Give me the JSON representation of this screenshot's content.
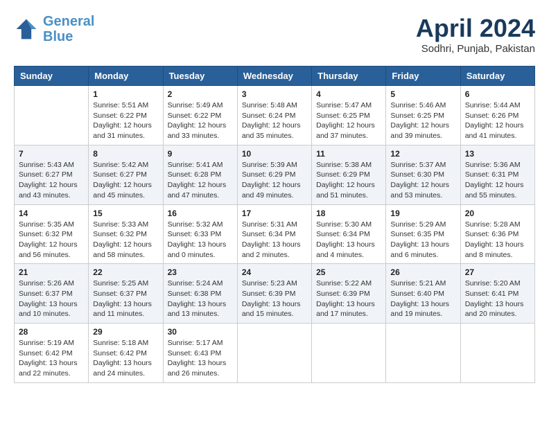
{
  "header": {
    "logo_line1": "General",
    "logo_line2": "Blue",
    "month": "April 2024",
    "location": "Sodhri, Punjab, Pakistan"
  },
  "days_of_week": [
    "Sunday",
    "Monday",
    "Tuesday",
    "Wednesday",
    "Thursday",
    "Friday",
    "Saturday"
  ],
  "weeks": [
    [
      {
        "day": "",
        "info": ""
      },
      {
        "day": "1",
        "info": "Sunrise: 5:51 AM\nSunset: 6:22 PM\nDaylight: 12 hours\nand 31 minutes."
      },
      {
        "day": "2",
        "info": "Sunrise: 5:49 AM\nSunset: 6:22 PM\nDaylight: 12 hours\nand 33 minutes."
      },
      {
        "day": "3",
        "info": "Sunrise: 5:48 AM\nSunset: 6:24 PM\nDaylight: 12 hours\nand 35 minutes."
      },
      {
        "day": "4",
        "info": "Sunrise: 5:47 AM\nSunset: 6:25 PM\nDaylight: 12 hours\nand 37 minutes."
      },
      {
        "day": "5",
        "info": "Sunrise: 5:46 AM\nSunset: 6:25 PM\nDaylight: 12 hours\nand 39 minutes."
      },
      {
        "day": "6",
        "info": "Sunrise: 5:44 AM\nSunset: 6:26 PM\nDaylight: 12 hours\nand 41 minutes."
      }
    ],
    [
      {
        "day": "7",
        "info": "Sunrise: 5:43 AM\nSunset: 6:27 PM\nDaylight: 12 hours\nand 43 minutes."
      },
      {
        "day": "8",
        "info": "Sunrise: 5:42 AM\nSunset: 6:27 PM\nDaylight: 12 hours\nand 45 minutes."
      },
      {
        "day": "9",
        "info": "Sunrise: 5:41 AM\nSunset: 6:28 PM\nDaylight: 12 hours\nand 47 minutes."
      },
      {
        "day": "10",
        "info": "Sunrise: 5:39 AM\nSunset: 6:29 PM\nDaylight: 12 hours\nand 49 minutes."
      },
      {
        "day": "11",
        "info": "Sunrise: 5:38 AM\nSunset: 6:29 PM\nDaylight: 12 hours\nand 51 minutes."
      },
      {
        "day": "12",
        "info": "Sunrise: 5:37 AM\nSunset: 6:30 PM\nDaylight: 12 hours\nand 53 minutes."
      },
      {
        "day": "13",
        "info": "Sunrise: 5:36 AM\nSunset: 6:31 PM\nDaylight: 12 hours\nand 55 minutes."
      }
    ],
    [
      {
        "day": "14",
        "info": "Sunrise: 5:35 AM\nSunset: 6:32 PM\nDaylight: 12 hours\nand 56 minutes."
      },
      {
        "day": "15",
        "info": "Sunrise: 5:33 AM\nSunset: 6:32 PM\nDaylight: 12 hours\nand 58 minutes."
      },
      {
        "day": "16",
        "info": "Sunrise: 5:32 AM\nSunset: 6:33 PM\nDaylight: 13 hours\nand 0 minutes."
      },
      {
        "day": "17",
        "info": "Sunrise: 5:31 AM\nSunset: 6:34 PM\nDaylight: 13 hours\nand 2 minutes."
      },
      {
        "day": "18",
        "info": "Sunrise: 5:30 AM\nSunset: 6:34 PM\nDaylight: 13 hours\nand 4 minutes."
      },
      {
        "day": "19",
        "info": "Sunrise: 5:29 AM\nSunset: 6:35 PM\nDaylight: 13 hours\nand 6 minutes."
      },
      {
        "day": "20",
        "info": "Sunrise: 5:28 AM\nSunset: 6:36 PM\nDaylight: 13 hours\nand 8 minutes."
      }
    ],
    [
      {
        "day": "21",
        "info": "Sunrise: 5:26 AM\nSunset: 6:37 PM\nDaylight: 13 hours\nand 10 minutes."
      },
      {
        "day": "22",
        "info": "Sunrise: 5:25 AM\nSunset: 6:37 PM\nDaylight: 13 hours\nand 11 minutes."
      },
      {
        "day": "23",
        "info": "Sunrise: 5:24 AM\nSunset: 6:38 PM\nDaylight: 13 hours\nand 13 minutes."
      },
      {
        "day": "24",
        "info": "Sunrise: 5:23 AM\nSunset: 6:39 PM\nDaylight: 13 hours\nand 15 minutes."
      },
      {
        "day": "25",
        "info": "Sunrise: 5:22 AM\nSunset: 6:39 PM\nDaylight: 13 hours\nand 17 minutes."
      },
      {
        "day": "26",
        "info": "Sunrise: 5:21 AM\nSunset: 6:40 PM\nDaylight: 13 hours\nand 19 minutes."
      },
      {
        "day": "27",
        "info": "Sunrise: 5:20 AM\nSunset: 6:41 PM\nDaylight: 13 hours\nand 20 minutes."
      }
    ],
    [
      {
        "day": "28",
        "info": "Sunrise: 5:19 AM\nSunset: 6:42 PM\nDaylight: 13 hours\nand 22 minutes."
      },
      {
        "day": "29",
        "info": "Sunrise: 5:18 AM\nSunset: 6:42 PM\nDaylight: 13 hours\nand 24 minutes."
      },
      {
        "day": "30",
        "info": "Sunrise: 5:17 AM\nSunset: 6:43 PM\nDaylight: 13 hours\nand 26 minutes."
      },
      {
        "day": "",
        "info": ""
      },
      {
        "day": "",
        "info": ""
      },
      {
        "day": "",
        "info": ""
      },
      {
        "day": "",
        "info": ""
      }
    ]
  ]
}
